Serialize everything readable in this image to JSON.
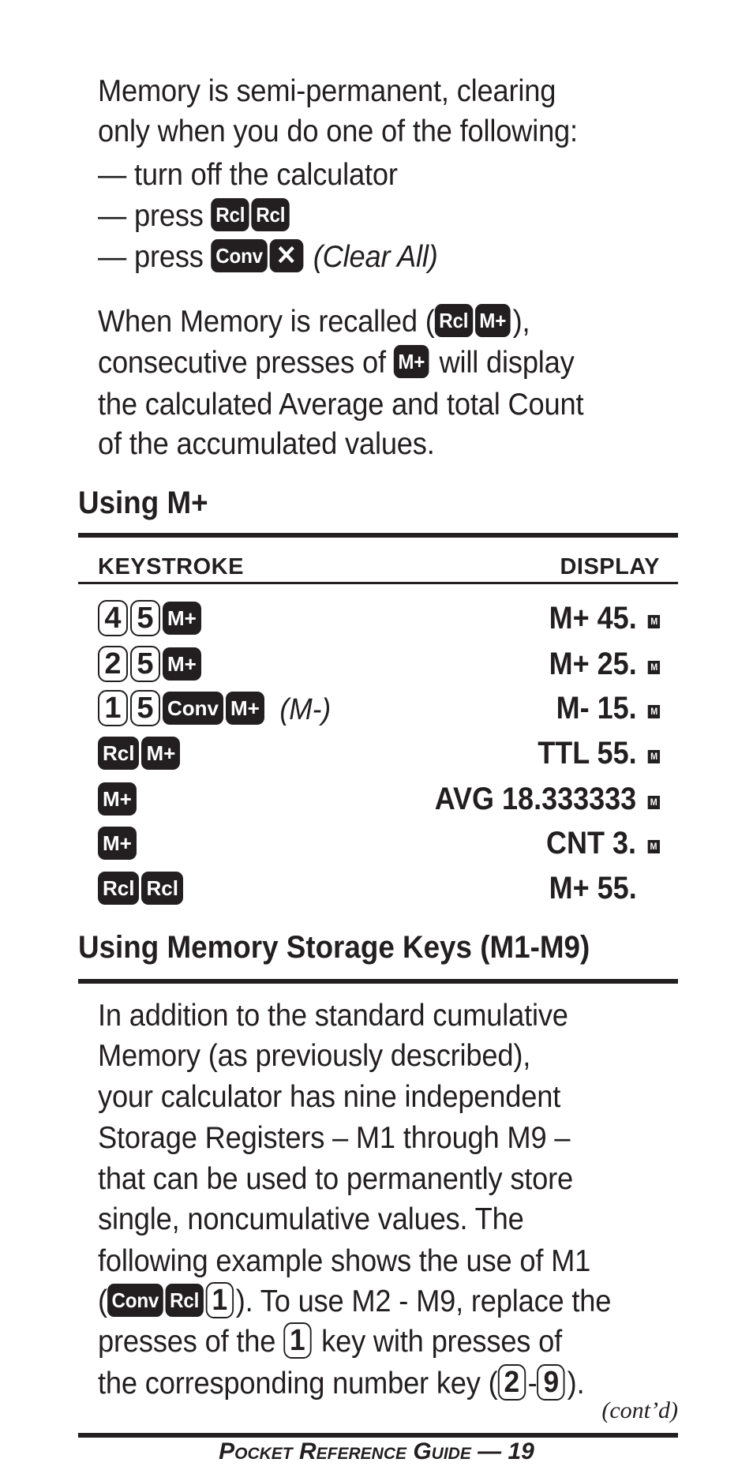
{
  "intro": {
    "line1": "Memory is semi-permanent, clearing",
    "line2": "only when you do one of the following:",
    "bullet_dash": "—",
    "bullet1": "turn off the calculator",
    "bullet2_prefix": "press",
    "bullet2_keys": [
      "Rcl",
      "Rcl"
    ],
    "bullet3_prefix": "press",
    "bullet3_keys": [
      "Conv",
      "✕"
    ],
    "bullet3_note": "(Clear All)"
  },
  "recall": {
    "line1_prefix": "When Memory is recalled (",
    "line1_keys": [
      "Rcl",
      "M+"
    ],
    "line1_suffix": "),",
    "line2_prefix": "consecutive presses of",
    "line2_key": "M+",
    "line2_suffix": "will display",
    "line3": "the calculated Average and total Count",
    "line4": "of the accumulated values."
  },
  "section_mplus": {
    "heading": "Using M+",
    "col_keystroke": "KEYSTROKE",
    "col_display": "DISPLAY",
    "memory_indicator": "M",
    "rows": [
      {
        "keys": [
          {
            "label": "4",
            "style": "light"
          },
          {
            "label": "5",
            "style": "light"
          },
          {
            "label": "M+",
            "style": "dark"
          }
        ],
        "note": "",
        "display": "M+ 45.",
        "indicator": true
      },
      {
        "keys": [
          {
            "label": "2",
            "style": "light"
          },
          {
            "label": "5",
            "style": "light"
          },
          {
            "label": "M+",
            "style": "dark"
          }
        ],
        "note": "",
        "display": "M+ 25.",
        "indicator": true
      },
      {
        "keys": [
          {
            "label": "1",
            "style": "light"
          },
          {
            "label": "5",
            "style": "light"
          },
          {
            "label": "Conv",
            "style": "dark"
          },
          {
            "label": "M+",
            "style": "dark"
          }
        ],
        "note": "(M-)",
        "display": "M- 15.",
        "indicator": true
      },
      {
        "keys": [
          {
            "label": "Rcl",
            "style": "dark"
          },
          {
            "label": "M+",
            "style": "dark"
          }
        ],
        "note": "",
        "display": "TTL 55.",
        "indicator": true
      },
      {
        "keys": [
          {
            "label": "M+",
            "style": "dark"
          }
        ],
        "note": "",
        "display": "AVG 18.333333",
        "indicator": true
      },
      {
        "keys": [
          {
            "label": "M+",
            "style": "dark"
          }
        ],
        "note": "",
        "display": "CNT 3.",
        "indicator": true
      },
      {
        "keys": [
          {
            "label": "Rcl",
            "style": "dark"
          },
          {
            "label": "Rcl",
            "style": "dark"
          }
        ],
        "note": "",
        "display": "M+ 55.",
        "indicator": false
      }
    ]
  },
  "section_storage": {
    "heading": "Using Memory Storage Keys (M1-M9)",
    "lines": [
      "In addition to the standard cumulative",
      "Memory (as previously described),",
      "your calculator has nine independent",
      "Storage Registers – M1 through M9 –",
      "that can be used to permanently store",
      "single, noncumulative values. The",
      "following example shows the use of M1"
    ],
    "line8_open": "(",
    "line8_keys": [
      "Conv",
      "Rcl",
      "1"
    ],
    "line8_suffix": "). To use M2 - M9, replace the",
    "line9_prefix": "presses of the",
    "line9_key": "1",
    "line9_suffix": "key with presses of",
    "line10_prefix": "the corresponding number key (",
    "line10_key_from": "2",
    "line10_dash": "-",
    "line10_key_to": "9",
    "line10_suffix": ").",
    "contd": "(cont’d)"
  },
  "footer": {
    "text": "Pocket Reference Guide — 19"
  }
}
